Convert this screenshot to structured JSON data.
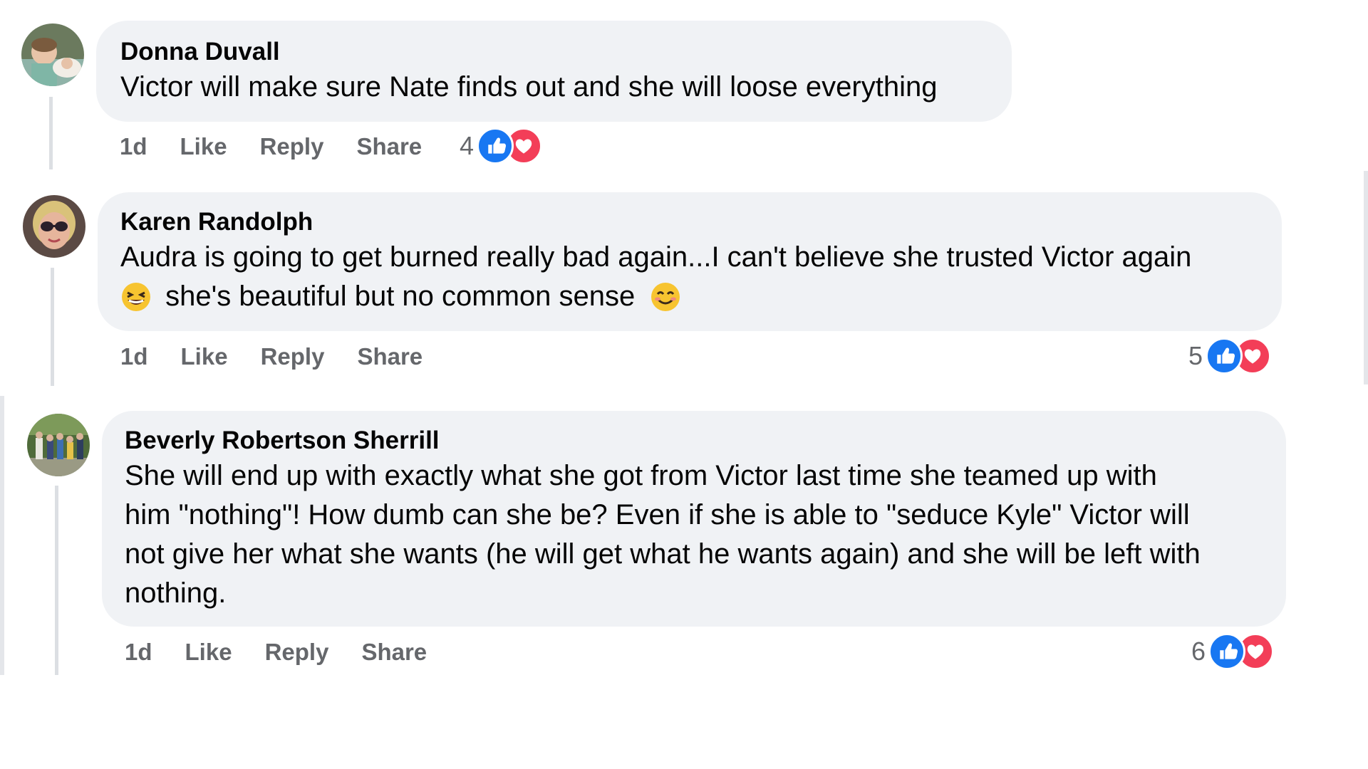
{
  "comments": [
    {
      "author": "Donna Duvall",
      "text": "Victor will make sure Nate finds out and she will loose everything",
      "actions": {
        "time": "1d",
        "like": "Like",
        "reply": "Reply",
        "share": "Share"
      },
      "reaction_count": "4",
      "reaction_icons": [
        "like-icon",
        "love-icon"
      ]
    },
    {
      "author": "Karen Randolph",
      "text_line1": "Audra is going to get burned really bad again...I can't believe she trusted Victor again",
      "text_line2": "she's beautiful but no common sense",
      "emojis": [
        "laughing-emoji",
        "smiling-emoji"
      ],
      "actions": {
        "time": "1d",
        "like": "Like",
        "reply": "Reply",
        "share": "Share"
      },
      "reaction_count": "5",
      "reaction_icons": [
        "like-icon",
        "love-icon"
      ]
    },
    {
      "author": "Beverly Robertson Sherrill",
      "text_lines": [
        "She will end up with exactly what she got from Victor last time she teamed up with",
        "him \"nothing\"! How dumb can she be? Even if she is able to \"seduce Kyle\" Victor will",
        "not give her what she wants (he will get what he wants again) and she will be left with",
        "nothing."
      ],
      "actions": {
        "time": "1d",
        "like": "Like",
        "reply": "Reply",
        "share": "Share"
      },
      "reaction_count": "6",
      "reaction_icons": [
        "like-icon",
        "love-icon"
      ]
    }
  ],
  "colors": {
    "bubble": "#f0f2f5",
    "meta_text": "#65676b",
    "like_blue": "#1877f2",
    "love_red": "#f33e58"
  }
}
